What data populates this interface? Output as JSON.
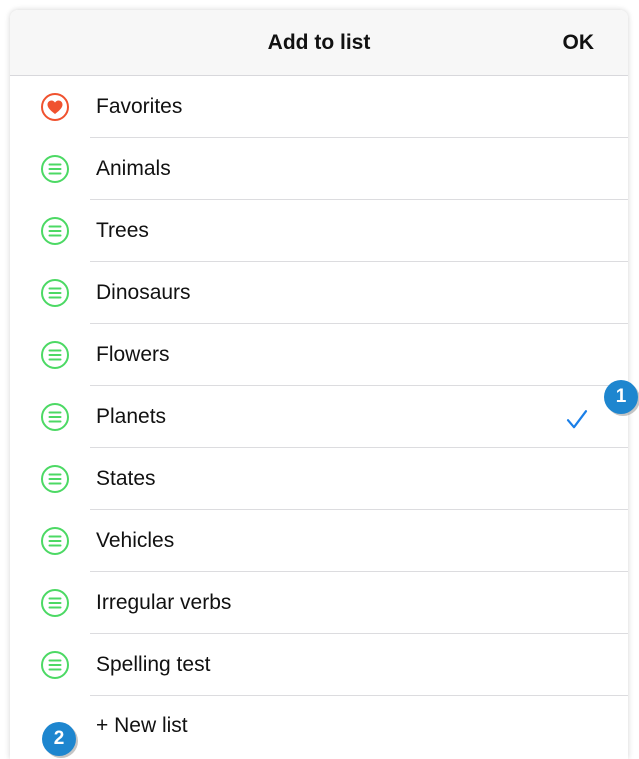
{
  "header": {
    "title": "Add to list",
    "ok_label": "OK"
  },
  "lists": [
    {
      "label": "Favorites",
      "icon": "heart-icon",
      "checked": false
    },
    {
      "label": "Animals",
      "icon": "list-icon",
      "checked": false
    },
    {
      "label": "Trees",
      "icon": "list-icon",
      "checked": false
    },
    {
      "label": "Dinosaurs",
      "icon": "list-icon",
      "checked": false
    },
    {
      "label": "Flowers",
      "icon": "list-icon",
      "checked": false
    },
    {
      "label": "Planets",
      "icon": "list-icon",
      "checked": true
    },
    {
      "label": "States",
      "icon": "list-icon",
      "checked": false
    },
    {
      "label": "Vehicles",
      "icon": "list-icon",
      "checked": false
    },
    {
      "label": "Irregular verbs",
      "icon": "list-icon",
      "checked": false
    },
    {
      "label": "Spelling test",
      "icon": "list-icon",
      "checked": false
    }
  ],
  "new_list_label": "+ New list",
  "annotations": {
    "badge_1": "1",
    "badge_2": "2"
  },
  "colors": {
    "list_icon": "#4cd964",
    "heart_icon": "#f0522f",
    "check": "#1a7fe8",
    "badge": "#1e86cf"
  }
}
